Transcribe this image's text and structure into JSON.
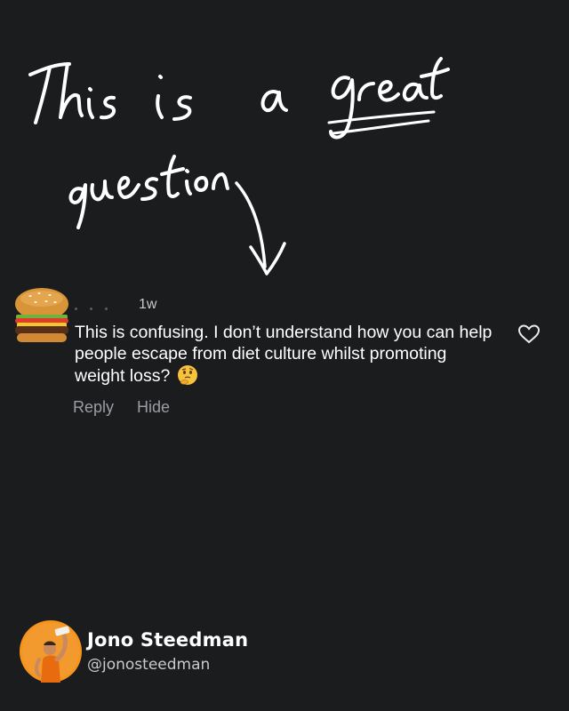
{
  "annotation": {
    "handwritten_line_1": "This is a great",
    "handwritten_line_2": "question"
  },
  "comment": {
    "age": "1w",
    "text": "This is confusing. I don’t understand how you can help people escape from diet culture whilst promoting weight loss?",
    "emoji": "thinking-face-emoji",
    "reply_label": "Reply",
    "hide_label": "Hide",
    "avatar_icon": "hamburger-emoji"
  },
  "author": {
    "name": "Jono Steedman",
    "handle": "@jonosteedman",
    "avatar_color": "#f7941d"
  }
}
